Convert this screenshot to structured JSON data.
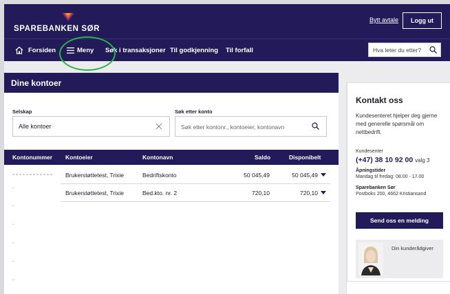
{
  "header": {
    "brand": "SPAREBANKEN SØR",
    "switch_agreement": "Bytt avtale",
    "logout": "Logg ut"
  },
  "nav": {
    "home": "Forsiden",
    "menu": "Meny",
    "search_transactions": "Søk i transaksjoner",
    "for_approval": "Til godkjenning",
    "due": "Til forfall",
    "search_placeholder": "Hva leter du etter?"
  },
  "accounts": {
    "title": "Dine kontoer",
    "company_label": "Selskap",
    "company_value": "Alle kontoer",
    "search_label": "Søk etter konto",
    "search_placeholder": "Søk etter kontonr., kontoeier, kontonavn",
    "columns": [
      "Kontonummer",
      "Kontoeier",
      "Kontonavn",
      "Saldo",
      "Disponibelt"
    ],
    "rows": [
      {
        "owner": "Brukerstøttetest, Trixie",
        "name": "Bedriftskonto",
        "balance": "50 045,49",
        "available": "50 045,49"
      },
      {
        "owner": "Brukerstøttetest, Trixie",
        "name": "Bed.kto. nr. 2",
        "balance": "720,10",
        "available": "720,10"
      }
    ]
  },
  "contact": {
    "title": "Kontakt oss",
    "intro": "Kundesenteret hjelper deg gjerne med generelle spørsmål om nettbedrift.",
    "center_label": "Kundesenter",
    "phone": "(+47) 38 10 92 00",
    "phone_choice": "valg 3",
    "hours_label": "Åpningstider",
    "hours": "Mandag til fredag: 08.00 - 17.00",
    "bank_name": "Sparebanken Sør",
    "address": "Postboks 200, 4662 Kristiansand",
    "send_button": "Send oss en melding",
    "advisor_label": "Din kunderådgiver"
  },
  "colors": {
    "brand": "#231a5a",
    "highlight_ring": "#2bb34a"
  }
}
